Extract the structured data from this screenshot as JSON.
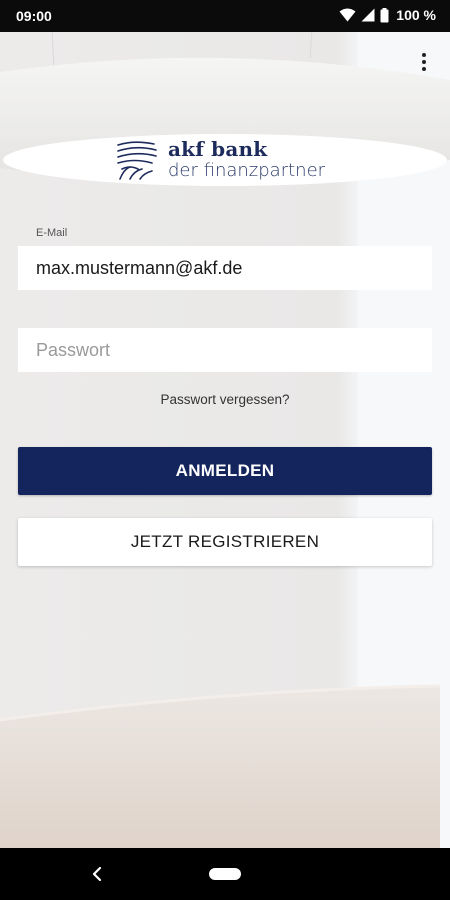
{
  "status_bar": {
    "time": "09:00",
    "battery": "100 %"
  },
  "icons": {
    "wifi": "wifi-icon",
    "signal": "cell-signal-icon",
    "battery": "battery-icon",
    "overflow": "more-vert-icon",
    "back": "back-icon",
    "home": "home-pill-icon"
  },
  "logo": {
    "name": "akf bank",
    "tagline": "der finanzpartner"
  },
  "login_form": {
    "email_label": "E-Mail",
    "email_value": "max.mustermann@akf.de",
    "password_placeholder": "Passwort",
    "password_value": "",
    "forgot_password": "Passwort vergessen?",
    "login_button": "ANMELDEN",
    "register_button": "JETZT REGISTRIEREN"
  },
  "colors": {
    "brand_navy": "#14245d",
    "logo_text": "#1d2b5c",
    "status_bar_bg": "#0b0b0b",
    "nav_bar_bg": "#000000"
  }
}
